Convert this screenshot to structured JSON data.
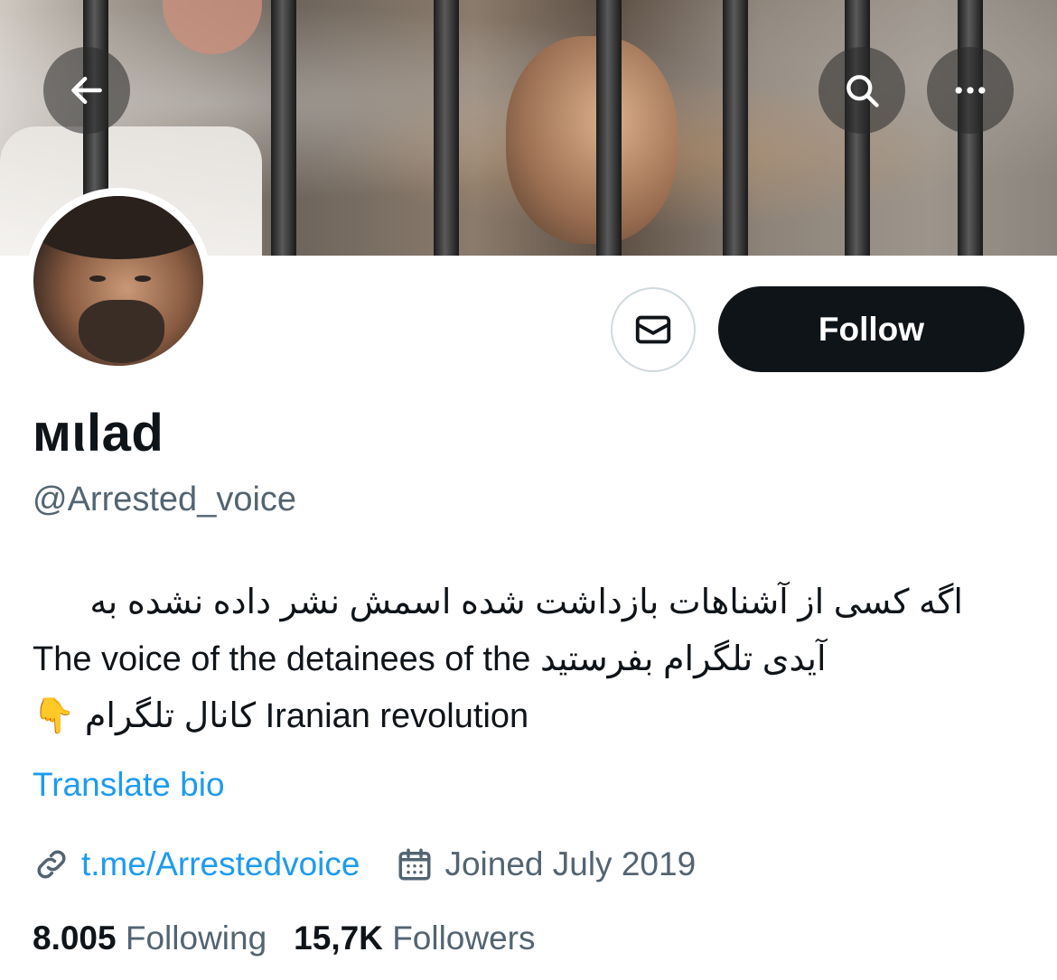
{
  "banner": {
    "description_icon": "header-image"
  },
  "nav": {
    "back_icon": "arrow-left-icon",
    "search_icon": "search-icon",
    "more_icon": "more-dots-icon"
  },
  "actions": {
    "message_icon": "envelope-icon",
    "follow_label": "Follow"
  },
  "profile": {
    "display_name": "ᴍιlad",
    "handle": "@Arrested_voice",
    "bio_line1": "اگه کسی از آشناهات بازداشت شده اسمش نشر داده نشده به",
    "bio_line2_rtl": "آیدی تلگرام بفرستید",
    "bio_line2_ltr": "The voice of the detainees of the",
    "bio_line3_ltr": "Iranian revolution",
    "bio_line3_rtl": "کانال تلگرام",
    "bio_line3_emoji": "👇",
    "translate_label": "Translate bio",
    "link_text": "t.me/Arrestedvoice",
    "joined_text": "Joined July 2019"
  },
  "stats": {
    "following_count": "8.005",
    "following_label": "Following",
    "followers_count": "15,7K",
    "followers_label": "Followers"
  },
  "colors": {
    "accent": "#1d9bf0",
    "text_primary": "#0f1419",
    "text_secondary": "#536471",
    "follow_bg": "#0f1419"
  }
}
